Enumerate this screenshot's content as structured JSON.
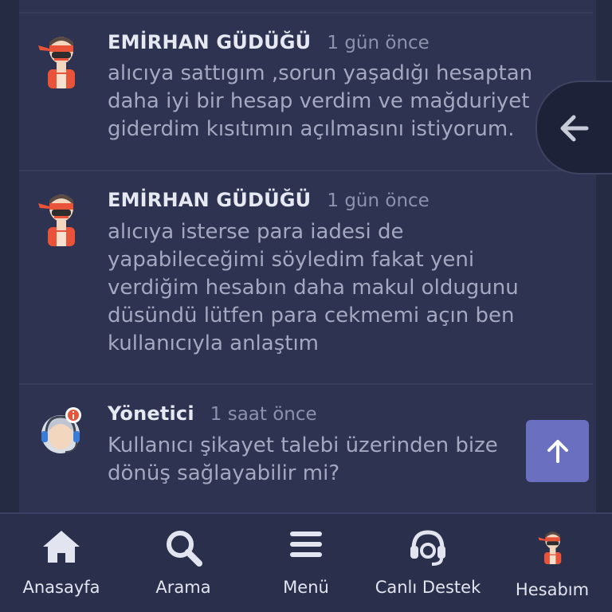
{
  "comments": [
    {
      "author": "EMİRHAN GÜDÜĞÜ",
      "time": "1 gün önce",
      "avatar": "ninja-user-avatar",
      "lines": [
        "alıcıya sattıgım ,sorun yaşadığı hesaptan",
        "daha iyi bir hesap verdim ve mağduriyet",
        "giderdim kısıtımın açılmasını istiyorum."
      ]
    },
    {
      "author": "EMİRHAN GÜDÜĞÜ",
      "time": "1 gün önce",
      "avatar": "ninja-user-avatar",
      "lines": [
        "alıcıya isterse para iadesi de",
        "yapabileceğimi söyledim fakat yeni",
        "verdiğim hesabın daha makul oldugunu",
        "düsündü lütfen para cekmemi açın ben",
        "kullanıcıyla anlaştım"
      ]
    },
    {
      "author": "Yönetici",
      "time": "1 saat önce",
      "avatar": "support-agent-avatar",
      "lines": [
        "Kullanıcı şikayet talebi üzerinden bize",
        "dönüş sağlayabilir mi?"
      ]
    }
  ],
  "nav": [
    {
      "label": "Anasayfa",
      "icon": "home-icon"
    },
    {
      "label": "Arama",
      "icon": "search-icon"
    },
    {
      "label": "Menü",
      "icon": "menu-icon"
    },
    {
      "label": "Canlı Destek",
      "icon": "headset-icon"
    },
    {
      "label": "Hesabım",
      "icon": "account-avatar-icon"
    }
  ],
  "colors": {
    "background": "#262b44",
    "panel": "#2d3350",
    "accent": "#6b6fc0",
    "avatar_red": "#e8533a"
  }
}
